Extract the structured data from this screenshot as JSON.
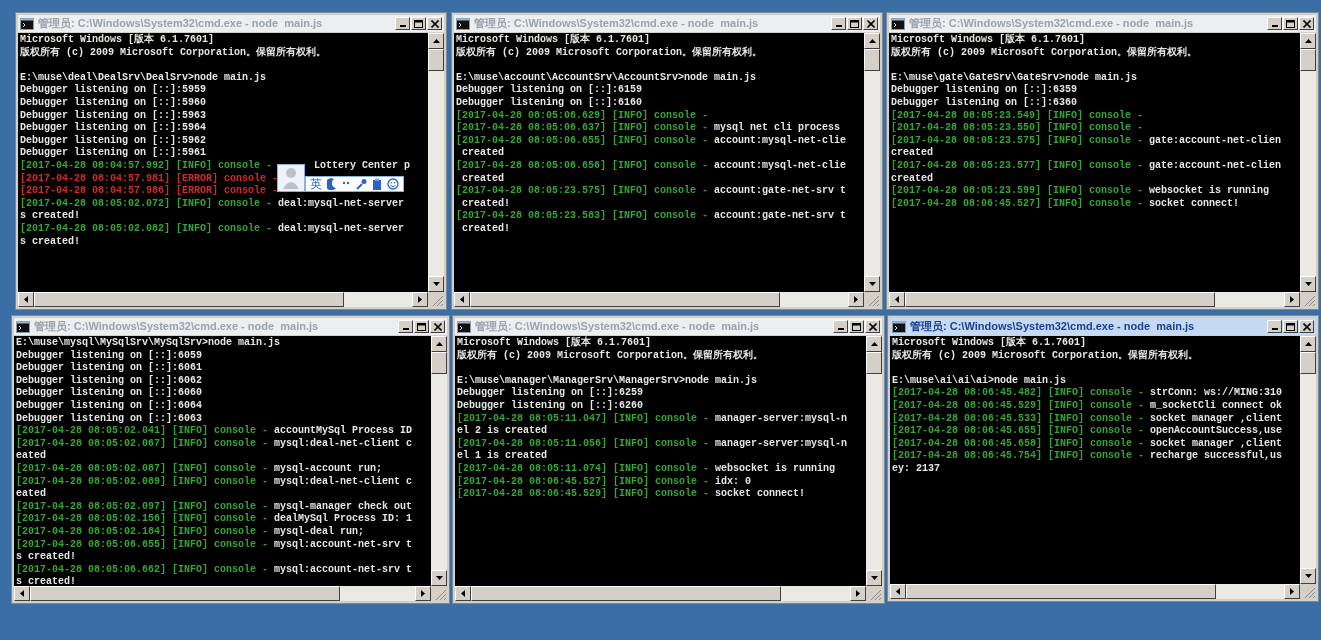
{
  "windows": [
    {
      "title": "管理员: C:\\Windows\\System32\\cmd.exe - node  main.js",
      "active": false,
      "ime_toolbar": {
        "label": "英"
      },
      "lines": [
        {
          "kind": "text",
          "text": "Microsoft Windows [版本 6.1.7601]"
        },
        {
          "kind": "text",
          "text": "版权所有 (c) 2009 Microsoft Corporation。保留所有权利。"
        },
        {
          "kind": "blank"
        },
        {
          "kind": "text",
          "text": "E:\\muse\\deal\\DealSrv\\DealSrv>node main.js"
        },
        {
          "kind": "text",
          "text": "Debugger listening on [::]:5959"
        },
        {
          "kind": "text",
          "text": "Debugger listening on [::]:5960"
        },
        {
          "kind": "text",
          "text": "Debugger listening on [::]:5963"
        },
        {
          "kind": "text",
          "text": "Debugger listening on [::]:5964"
        },
        {
          "kind": "text",
          "text": "Debugger listening on [::]:5962"
        },
        {
          "kind": "text",
          "text": "Debugger listening on [::]:5961"
        },
        {
          "kind": "info",
          "prefix": "[2017-04-28 08:04:57.992] [INFO] console -",
          "message": "Lottery Center p",
          "covered": true
        },
        {
          "kind": "error",
          "prefix": "[2017-04-28 08:04:57.981] [ERROR] console -",
          "covered": true
        },
        {
          "kind": "error",
          "prefix": "[2017-04-28 08:04:57.986] [ERROR] console -",
          "covered": true
        },
        {
          "kind": "info",
          "prefix": "[2017-04-28 08:05:02.072] [INFO] console -",
          "message": "deal:mysql-net-server"
        },
        {
          "kind": "text",
          "text": "s created!"
        },
        {
          "kind": "info",
          "prefix": "[2017-04-28 08:05:02.082] [INFO] console -",
          "message": "deal:mysql-net-server"
        },
        {
          "kind": "text",
          "text": "s created!"
        }
      ]
    },
    {
      "title": "管理员: C:\\Windows\\System32\\cmd.exe - node  main.js",
      "active": false,
      "lines": [
        {
          "kind": "text",
          "text": "Microsoft Windows [版本 6.1.7601]"
        },
        {
          "kind": "text",
          "text": "版权所有 (c) 2009 Microsoft Corporation。保留所有权利。"
        },
        {
          "kind": "blank"
        },
        {
          "kind": "text",
          "text": "E:\\muse\\account\\AccountSrv\\AccountSrv>node main.js"
        },
        {
          "kind": "text",
          "text": "Debugger listening on [::]:6159"
        },
        {
          "kind": "text",
          "text": "Debugger listening on [::]:6160"
        },
        {
          "kind": "info",
          "prefix": "[2017-04-28 08:05:06.629] [INFO] console -"
        },
        {
          "kind": "info",
          "prefix": "[2017-04-28 08:05:06.637] [INFO] console -",
          "message": "mysql net cli process"
        },
        {
          "kind": "info",
          "prefix": "[2017-04-28 08:05:06.655] [INFO] console -",
          "message": "account:mysql-net-clie"
        },
        {
          "kind": "text",
          "text": " created"
        },
        {
          "kind": "info",
          "prefix": "[2017-04-28 08:05:06.656] [INFO] console -",
          "message": "account:mysql-net-clie"
        },
        {
          "kind": "text",
          "text": " created"
        },
        {
          "kind": "info",
          "prefix": "[2017-04-28 08:05:23.575] [INFO] console -",
          "message": "account:gate-net-srv t"
        },
        {
          "kind": "text",
          "text": " created!"
        },
        {
          "kind": "info",
          "prefix": "[2017-04-28 08:05:23.583] [INFO] console -",
          "message": "account:gate-net-srv t"
        },
        {
          "kind": "text",
          "text": " created!"
        }
      ]
    },
    {
      "title": "管理员: C:\\Windows\\System32\\cmd.exe - node  main.js",
      "active": false,
      "lines": [
        {
          "kind": "text",
          "text": "Microsoft Windows [版本 6.1.7601]"
        },
        {
          "kind": "text",
          "text": "版权所有 (c) 2009 Microsoft Corporation。保留所有权利。"
        },
        {
          "kind": "blank"
        },
        {
          "kind": "text",
          "text": "E:\\muse\\gate\\GateSrv\\GateSrv>node main.js"
        },
        {
          "kind": "text",
          "text": "Debugger listening on [::]:6359"
        },
        {
          "kind": "text",
          "text": "Debugger listening on [::]:6360"
        },
        {
          "kind": "info",
          "prefix": "[2017-04-28 08:05:23.549] [INFO] console -"
        },
        {
          "kind": "info",
          "prefix": "[2017-04-28 08:05:23.550] [INFO] console -"
        },
        {
          "kind": "info",
          "prefix": "[2017-04-28 08:05:23.575] [INFO] console -",
          "message": "gate:account-net-clien"
        },
        {
          "kind": "text",
          "text": "created"
        },
        {
          "kind": "info",
          "prefix": "[2017-04-28 08:05:23.577] [INFO] console -",
          "message": "gate:account-net-clien"
        },
        {
          "kind": "text",
          "text": "created"
        },
        {
          "kind": "info",
          "prefix": "[2017-04-28 08:05:23.599] [INFO] console -",
          "message": "websocket is running"
        },
        {
          "kind": "info",
          "prefix": "[2017-04-28 08:06:45.527] [INFO] console -",
          "message": "socket connect!"
        }
      ]
    },
    {
      "title": "管理员: C:\\Windows\\System32\\cmd.exe - node  main.js",
      "active": false,
      "lines": [
        {
          "kind": "text",
          "text": "E:\\muse\\mysql\\MySqlSrv\\MySqlSrv>node main.js"
        },
        {
          "kind": "text",
          "text": "Debugger listening on [::]:6059"
        },
        {
          "kind": "text",
          "text": "Debugger listening on [::]:6061"
        },
        {
          "kind": "text",
          "text": "Debugger listening on [::]:6062"
        },
        {
          "kind": "text",
          "text": "Debugger listening on [::]:6060"
        },
        {
          "kind": "text",
          "text": "Debugger listening on [::]:6064"
        },
        {
          "kind": "text",
          "text": "Debugger listening on [::]:6063"
        },
        {
          "kind": "info",
          "prefix": "[2017-04-28 08:05:02.041] [INFO] console -",
          "message": "accountMySql Process ID"
        },
        {
          "kind": "info",
          "prefix": "[2017-04-28 08:05:02.067] [INFO] console -",
          "message": "mysql:deal-net-client c"
        },
        {
          "kind": "text",
          "text": "eated"
        },
        {
          "kind": "info",
          "prefix": "[2017-04-28 08:05:02.087] [INFO] console -",
          "message": "mysql-account run;"
        },
        {
          "kind": "info",
          "prefix": "[2017-04-28 08:05:02.089] [INFO] console -",
          "message": "mysql:deal-net-client c"
        },
        {
          "kind": "text",
          "text": "eated"
        },
        {
          "kind": "info",
          "prefix": "[2017-04-28 08:05:02.097] [INFO] console -",
          "message": "mysql-manager check out"
        },
        {
          "kind": "info",
          "prefix": "[2017-04-28 08:05:02.156] [INFO] console -",
          "message": "dealMySql Process ID: 1"
        },
        {
          "kind": "info",
          "prefix": "[2017-04-28 08:05:02.184] [INFO] console -",
          "message": "mysql-deal run;"
        },
        {
          "kind": "info",
          "prefix": "[2017-04-28 08:05:06.655] [INFO] console -",
          "message": "mysql:account-net-srv t"
        },
        {
          "kind": "text",
          "text": "s created!"
        },
        {
          "kind": "info",
          "prefix": "[2017-04-28 08:05:06.662] [INFO] console -",
          "message": "mysql:account-net-srv t"
        },
        {
          "kind": "text",
          "text": "s created!"
        }
      ]
    },
    {
      "title": "管理员: C:\\Windows\\System32\\cmd.exe - node  main.js",
      "active": false,
      "lines": [
        {
          "kind": "text",
          "text": "Microsoft Windows [版本 6.1.7601]"
        },
        {
          "kind": "text",
          "text": "版权所有 (c) 2009 Microsoft Corporation。保留所有权利。"
        },
        {
          "kind": "blank"
        },
        {
          "kind": "text",
          "text": "E:\\muse\\manager\\ManagerSrv\\ManagerSrv>node main.js"
        },
        {
          "kind": "text",
          "text": "Debugger listening on [::]:6259"
        },
        {
          "kind": "text",
          "text": "Debugger listening on [::]:6260"
        },
        {
          "kind": "info",
          "prefix": "[2017-04-28 08:05:11.047] [INFO] console -",
          "message": "manager-server:mysql-n"
        },
        {
          "kind": "text",
          "text": "el 2 is created"
        },
        {
          "kind": "info",
          "prefix": "[2017-04-28 08:05:11.056] [INFO] console -",
          "message": "manager-server:mysql-n"
        },
        {
          "kind": "text",
          "text": "el 1 is created"
        },
        {
          "kind": "info",
          "prefix": "[2017-04-28 08:05:11.074] [INFO] console -",
          "message": "websocket is running"
        },
        {
          "kind": "info",
          "prefix": "[2017-04-28 08:06:45.527] [INFO] console -",
          "message": "idx: 0"
        },
        {
          "kind": "info",
          "prefix": "[2017-04-28 08:06:45.529] [INFO] console -",
          "message": "socket connect!"
        }
      ]
    },
    {
      "title": "管理员: C:\\Windows\\System32\\cmd.exe - node  main.js",
      "active": true,
      "lines": [
        {
          "kind": "text",
          "text": "Microsoft Windows [版本 6.1.7601]"
        },
        {
          "kind": "text",
          "text": "版权所有 (c) 2009 Microsoft Corporation。保留所有权利。"
        },
        {
          "kind": "blank"
        },
        {
          "kind": "text",
          "text": "E:\\muse\\ai\\ai\\ai>node main.js"
        },
        {
          "kind": "info",
          "prefix": "[2017-04-28 08:06:45.482] [INFO] console -",
          "message": "strConn: ws://MING:310"
        },
        {
          "kind": "info",
          "prefix": "[2017-04-28 08:06:45.529] [INFO] console -",
          "message": "m_socketCli connect ok"
        },
        {
          "kind": "info",
          "prefix": "[2017-04-28 08:06:45.533] [INFO] console -",
          "message": "socket manager ,client"
        },
        {
          "kind": "info",
          "prefix": "[2017-04-28 08:06:45.655] [INFO] console -",
          "message": "openAccountSuccess,use"
        },
        {
          "kind": "info",
          "prefix": "[2017-04-28 08:06:45.658] [INFO] console -",
          "message": "socket manager ,client"
        },
        {
          "kind": "info",
          "prefix": "[2017-04-28 08:06:45.754] [INFO] console -",
          "message": "recharge successful,us"
        },
        {
          "kind": "text",
          "text": "ey: 2137"
        }
      ]
    }
  ]
}
